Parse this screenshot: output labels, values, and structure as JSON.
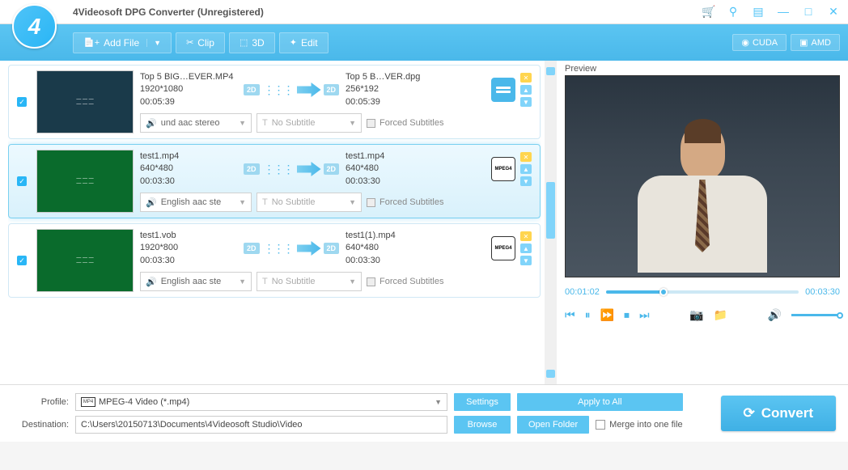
{
  "window": {
    "title": "4Videosoft DPG Converter (Unregistered)",
    "logo_text": "4"
  },
  "toolbar": {
    "add_file": "Add File",
    "clip": "Clip",
    "three_d": "3D",
    "edit": "Edit",
    "cuda": "CUDA",
    "amd": "AMD"
  },
  "files": [
    {
      "checked": true,
      "src_name": "Top 5 BIG…EVER.MP4",
      "src_res": "1920*1080",
      "src_dur": "00:05:39",
      "dst_name": "Top 5 B…VER.dpg",
      "dst_res": "256*192",
      "dst_dur": "00:05:39",
      "audio": "und aac stereo",
      "subtitle": "No Subtitle",
      "forced": "Forced Subtitles",
      "format": "dpg",
      "thumb": "blue"
    },
    {
      "checked": true,
      "src_name": "test1.mp4",
      "src_res": "640*480",
      "src_dur": "00:03:30",
      "dst_name": "test1.mp4",
      "dst_res": "640*480",
      "dst_dur": "00:03:30",
      "audio": "English aac ste",
      "subtitle": "No Subtitle",
      "forced": "Forced Subtitles",
      "format": "mpeg",
      "thumb": "green",
      "selected": true
    },
    {
      "checked": true,
      "src_name": "test1.vob",
      "src_res": "1920*800",
      "src_dur": "00:03:30",
      "dst_name": "test1(1).mp4",
      "dst_res": "640*480",
      "dst_dur": "00:03:30",
      "audio": "English aac ste",
      "subtitle": "No Subtitle",
      "forced": "Forced Subtitles",
      "format": "mpeg",
      "thumb": "green"
    }
  ],
  "preview": {
    "label": "Preview",
    "current_time": "00:01:02",
    "total_time": "00:03:30"
  },
  "profile": {
    "label": "Profile:",
    "value": "MPEG-4 Video (*.mp4)",
    "settings": "Settings",
    "apply_all": "Apply to All"
  },
  "destination": {
    "label": "Destination:",
    "value": "C:\\Users\\20150713\\Documents\\4Videosoft Studio\\Video",
    "browse": "Browse",
    "open_folder": "Open Folder"
  },
  "merge_label": "Merge into one file",
  "convert_label": "Convert",
  "badge_2d": "2D",
  "mpeg_label": "MPEG4"
}
